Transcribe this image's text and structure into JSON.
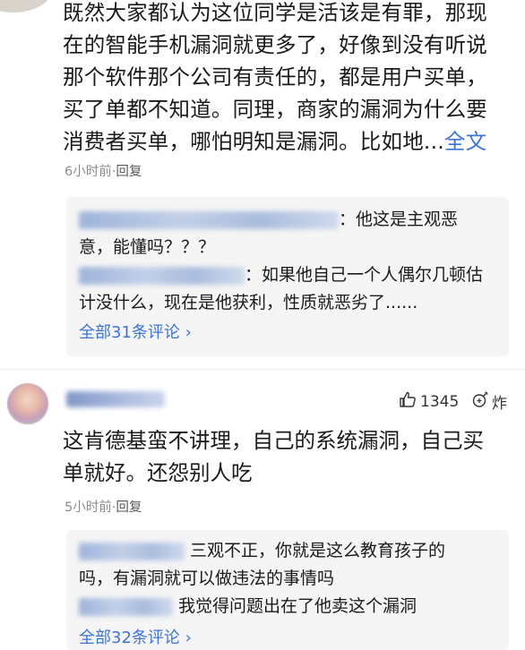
{
  "comment1": {
    "text_lines": [
      "既然大家都认为这位同学是活该是有罪，那现",
      "在的智能手机漏洞就更多了，好像到没有听说",
      "那个软件那个公司有责任的，都是用户买单，",
      "买了单都不知道。同理，商家的漏洞为什么要",
      "消费者买单，哪怕明知是漏洞。比如地..."
    ],
    "full_text_link": "全文",
    "time": "6小时前",
    "dot": "·",
    "reply": "回复",
    "replies": [
      {
        "text_a": "：他这是主观恶",
        "text_b": "意，能懂吗？？？"
      },
      {
        "text_a": "：如果他自己一个人偶尔几顿估",
        "text_b": "计没什么，现在是他获利，性质就恶劣了......"
      }
    ],
    "all_comments": "全部31条评论",
    "all_arrow": "›"
  },
  "comment2": {
    "likes": "1345",
    "bomb_label": "炸",
    "text_lines": [
      "这肯德基蛮不讲理，自己的系统漏洞，自己买",
      "单就好。还怨别人吃"
    ],
    "time": "5小时前",
    "dot": "·",
    "reply": "回复",
    "replies": [
      {
        "text_a": "三观不正，你就是这么教育孩子的",
        "text_b": "吗，有漏洞就可以做违法的事情吗"
      },
      {
        "text_a": "我觉得问题出在了他卖这个漏洞",
        "text_b": ""
      }
    ],
    "all_comments": "全部32条评论",
    "all_arrow": "›"
  }
}
